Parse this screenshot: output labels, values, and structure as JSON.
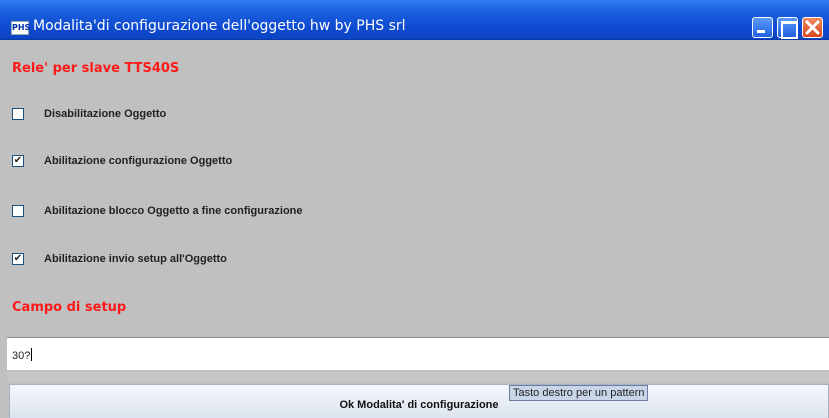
{
  "window": {
    "title": "Modalita'di configurazione dell'oggetto hw by PHS srl",
    "app_icon_text": "PHS"
  },
  "section_relay": {
    "title": "Rele' per slave TTS40S"
  },
  "options": [
    {
      "label": "Disabilitazione Oggetto",
      "checked": false
    },
    {
      "label": "Abilitazione configurazione Oggetto",
      "checked": true
    },
    {
      "label": "Abilitazione blocco Oggetto a fine configurazione",
      "checked": false
    },
    {
      "label": "Abilitazione invio setup all'Oggetto",
      "checked": true
    }
  ],
  "section_setup": {
    "title": "Campo di setup",
    "field_value": "30?"
  },
  "ok_button": {
    "label": "Ok Modalita' di configurazione"
  },
  "tooltip": {
    "text": "Tasto destro per un pattern"
  },
  "colors": {
    "section_title": "#ff1a1a",
    "titlebar": "#0f4bd0",
    "background": "#c0c0c0"
  }
}
